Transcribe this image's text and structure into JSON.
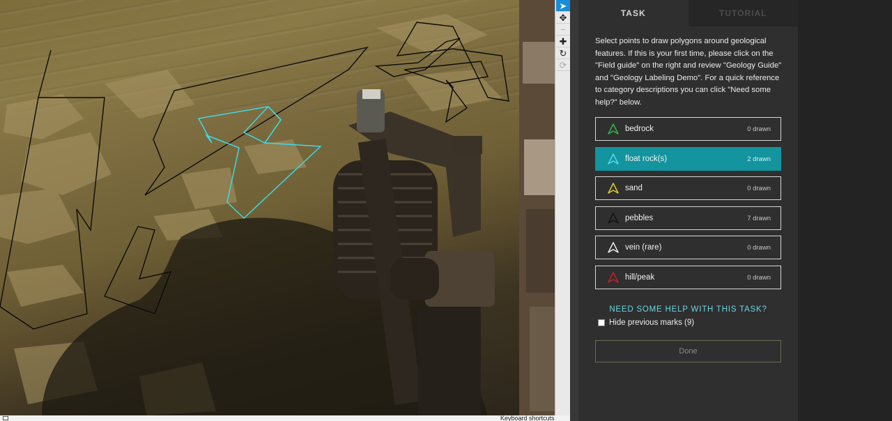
{
  "toolbar": {
    "tools": [
      {
        "name": "select-tool",
        "icon": "pointer-icon",
        "glyph": "➤"
      },
      {
        "name": "move-tool",
        "icon": "move-icon",
        "glyph": "✥"
      },
      {
        "name": "zoom-out-tool",
        "icon": "minus-icon",
        "glyph": "−"
      },
      {
        "name": "zoom-in-tool",
        "icon": "plus-icon",
        "glyph": "✚"
      },
      {
        "name": "rotate-tool",
        "icon": "rotate-icon",
        "glyph": "↻"
      },
      {
        "name": "reset-tool",
        "icon": "reset-icon",
        "glyph": "⟳"
      }
    ]
  },
  "tabs": {
    "task": "TASK",
    "tutorial": "TUTORIAL"
  },
  "instructions": "Select points to draw polygons around geological features. If this is your first time, please click on the \"Field guide\" on the right and review \"Geology Guide\" and \"Geology Labeling Demo\". For a quick reference to category descriptions you can click \"Need some help?\" below.",
  "choices": [
    {
      "label": "bedrock",
      "count": "0 drawn",
      "color": "#2bbf4a",
      "selected": false
    },
    {
      "label": "float rock(s)",
      "count": "2 drawn",
      "color": "#4fe0ec",
      "selected": true
    },
    {
      "label": "sand",
      "count": "0 drawn",
      "color": "#e3d23a",
      "selected": false
    },
    {
      "label": "pebbles",
      "count": "7 drawn",
      "color": "#111111",
      "selected": false
    },
    {
      "label": "vein (rare)",
      "count": "0 drawn",
      "color": "#f0f0f0",
      "selected": false
    },
    {
      "label": "hill/peak",
      "count": "0 drawn",
      "color": "#c9202a",
      "selected": false
    }
  ],
  "help": "NEED SOME HELP WITH THIS TASK?",
  "hide_marks": "Hide previous marks (9)",
  "done": "Done",
  "statusbar": {
    "keys": "Keyboard shortcuts"
  }
}
